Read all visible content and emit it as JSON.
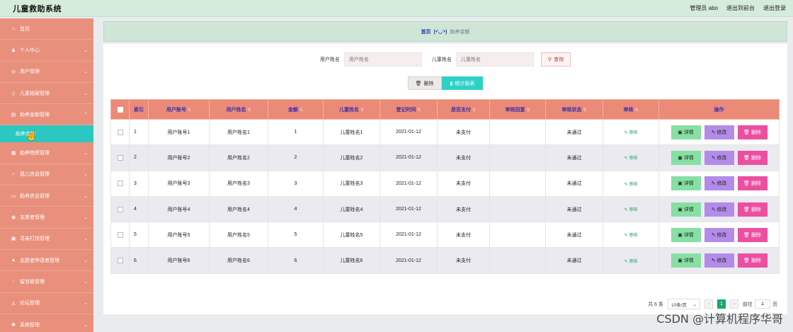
{
  "app": {
    "title": "儿童救助系统"
  },
  "topbar": {
    "user": "管理员 abo",
    "back_link": "退出到前台",
    "logout": "退出登录"
  },
  "sidebar": {
    "items": [
      {
        "label": "首页",
        "icon": "home-icon",
        "glyph": "⌂",
        "chevron": false
      },
      {
        "label": "个人中心",
        "icon": "user-icon",
        "glyph": "♟",
        "chevron": true
      },
      {
        "label": "用户管理",
        "icon": "user-manage-icon",
        "glyph": "◎",
        "chevron": true
      },
      {
        "label": "儿童档案管理",
        "icon": "profile-icon",
        "glyph": "▯",
        "chevron": true
      },
      {
        "label": "助养金额管理",
        "icon": "money-icon",
        "glyph": "▤",
        "chevron": true,
        "open": true
      },
      {
        "label": "助养物资管理",
        "icon": "goods-icon",
        "glyph": "▦",
        "chevron": true
      },
      {
        "label": "孤儿信息管理",
        "icon": "orphan-icon",
        "glyph": "♀",
        "chevron": true
      },
      {
        "label": "助养信息管理",
        "icon": "info-icon",
        "glyph": "▭",
        "chevron": true
      },
      {
        "label": "志愿者管理",
        "icon": "volunteer-icon",
        "glyph": "◉",
        "chevron": true
      },
      {
        "label": "寻亲打拐管理",
        "icon": "search-family-icon",
        "glyph": "▣",
        "chevron": true
      },
      {
        "label": "志愿者申请者管理",
        "icon": "apply-icon",
        "glyph": "▲",
        "chevron": true
      },
      {
        "label": "留言板管理",
        "icon": "message-icon",
        "glyph": "◌",
        "chevron": true
      },
      {
        "label": "论坛管理",
        "icon": "forum-icon",
        "glyph": "◬",
        "chevron": true
      },
      {
        "label": "系统管理",
        "icon": "system-icon",
        "glyph": "✱",
        "chevron": true
      }
    ],
    "sub_item": "助养金额"
  },
  "breadcrumb": {
    "home": "首页",
    "emoticon": "(•'◡'•)",
    "current": "助养金额"
  },
  "search": {
    "user_label": "用户姓名",
    "user_placeholder": "用户姓名",
    "child_label": "儿童姓名",
    "child_placeholder": "儿童姓名",
    "query_button": "查询"
  },
  "actions": {
    "delete": "删除",
    "stats": "统计报表"
  },
  "table": {
    "headers": [
      "索引",
      "用户账号",
      "用户姓名",
      "金额",
      "儿童姓名",
      "登记时间",
      "是否支付",
      "审核回复",
      "审核状态",
      "审核",
      "操作"
    ],
    "rows": [
      {
        "idx": "1",
        "account": "用户账号1",
        "name": "用户姓名1",
        "amount": "1",
        "child": "儿童姓名1",
        "date": "2021-01-12",
        "paid": "未支付",
        "reply": "",
        "status": "未通过",
        "audit": "审核"
      },
      {
        "idx": "2",
        "account": "用户账号2",
        "name": "用户姓名2",
        "amount": "2",
        "child": "儿童姓名2",
        "date": "2021-01-12",
        "paid": "未支付",
        "reply": "",
        "status": "未通过",
        "audit": "审核"
      },
      {
        "idx": "3",
        "account": "用户账号3",
        "name": "用户姓名3",
        "amount": "3",
        "child": "儿童姓名3",
        "date": "2021-01-12",
        "paid": "未支付",
        "reply": "",
        "status": "未通过",
        "audit": "审核"
      },
      {
        "idx": "4",
        "account": "用户账号4",
        "name": "用户姓名4",
        "amount": "4",
        "child": "儿童姓名4",
        "date": "2021-01-12",
        "paid": "未支付",
        "reply": "",
        "status": "未通过",
        "audit": "审核"
      },
      {
        "idx": "5",
        "account": "用户账号5",
        "name": "用户姓名5",
        "amount": "5",
        "child": "儿童姓名5",
        "date": "2021-01-12",
        "paid": "未支付",
        "reply": "",
        "status": "未通过",
        "audit": "审核"
      },
      {
        "idx": "6",
        "account": "用户账号6",
        "name": "用户姓名6",
        "amount": "6",
        "child": "儿童姓名6",
        "date": "2021-01-12",
        "paid": "未支付",
        "reply": "",
        "status": "未通过",
        "audit": "审核"
      }
    ],
    "op_detail": "详情",
    "op_edit": "修改",
    "op_delete": "删除"
  },
  "pagination": {
    "total": "共 6 条",
    "page_size": "10条/页",
    "current_page": "1",
    "goto_label": "前往",
    "goto_value": "1",
    "page_unit": "页"
  },
  "watermark": "CSDN @计算机程序华哥",
  "colors": {
    "sidebar": "#e8907c",
    "active": "#2ac8c0",
    "header": "#ea8a77",
    "topbar": "#d4ecd9"
  }
}
